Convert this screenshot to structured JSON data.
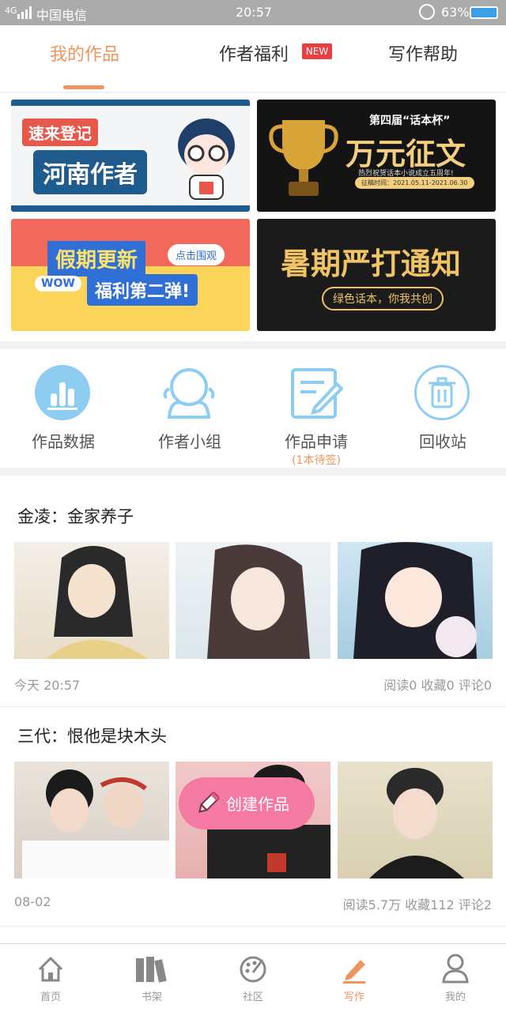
{
  "status_bar": {
    "signal": "4G",
    "carrier": "中国电信",
    "time": "20:57",
    "battery": "63%"
  },
  "tabs": [
    {
      "label": "我的作品",
      "active": true
    },
    {
      "label": "作者福利",
      "badge": "NEW"
    },
    {
      "label": "写作帮助"
    }
  ],
  "banners": [
    {
      "line1": "速来登记",
      "line2": "河南作者"
    },
    {
      "title": "第四届“话本杯”",
      "headline": "万元征文",
      "sub": "热烈祝贺话本小说成立五周年!",
      "date": "征稿时间：2021.05.11-2021.06.30"
    },
    {
      "line1": "假期更新",
      "tag": "点击围观",
      "wow": "WOW",
      "line2": "福利第二弹!"
    },
    {
      "headline": "暑期严打通知",
      "sub": "绿色话本，你我共创"
    }
  ],
  "tools": [
    {
      "label": "作品数据",
      "icon": "bar-chart-icon"
    },
    {
      "label": "作者小组",
      "icon": "group-icon"
    },
    {
      "label": "作品申请",
      "icon": "edit-document-icon",
      "sub": "(1本待签)"
    },
    {
      "label": "回收站",
      "icon": "trash-icon"
    }
  ],
  "works": [
    {
      "title": "金凌：金家养子",
      "date": "今天 20:57",
      "stats": "阅读0  收藏0  评论0"
    },
    {
      "title": "三代：恨他是块木头",
      "date": "08-02",
      "stats": "阅读5.7万  收藏112  评论2"
    }
  ],
  "fab": {
    "label": "创建作品",
    "icon": "pencil-icon"
  },
  "bottom_nav": [
    {
      "label": "首页",
      "icon": "home-icon"
    },
    {
      "label": "书架",
      "icon": "bookshelf-icon"
    },
    {
      "label": "社区",
      "icon": "palette-icon"
    },
    {
      "label": "写作",
      "icon": "write-icon",
      "active": true
    },
    {
      "label": "我的",
      "icon": "user-icon"
    }
  ],
  "colors": {
    "accent": "#f0955d",
    "fab": "#f57aa3",
    "tool_icon": "#7ec3ee",
    "badge": "#e84041"
  }
}
